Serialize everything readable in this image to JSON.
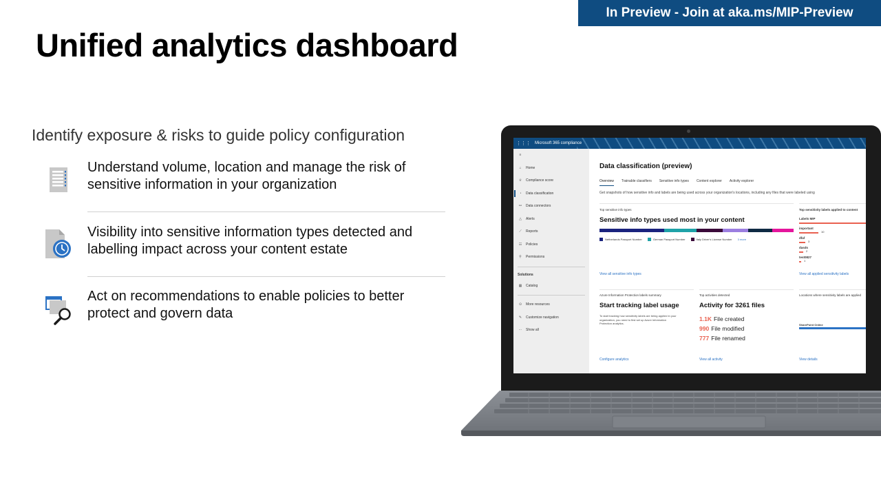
{
  "banner": "In Preview  - Join at aka.ms/MIP-Preview",
  "title": "Unified analytics dashboard",
  "subtitle": "Identify exposure & risks to guide policy configuration",
  "bullets": [
    {
      "icon": "document-list-icon",
      "line1": "Understand volume, location and manage the risk of",
      "line2": "sensitive information in your organization"
    },
    {
      "icon": "document-clock-icon",
      "line1": "Visibility into sensitive information types detected and",
      "line2": "labelling impact across your content estate"
    },
    {
      "icon": "window-search-icon",
      "line1": "Act on recommendations to enable policies to better",
      "line2": "protect and govern data"
    }
  ],
  "app": {
    "name": "Microsoft 365 compliance",
    "nav": [
      "Home",
      "Compliance score",
      "Data classification",
      "Data connectors",
      "Alerts",
      "Reports",
      "Policies",
      "Permissions"
    ],
    "nav_group": "Solutions",
    "nav_solutions": [
      "Catalog"
    ],
    "nav_bottom": [
      "More resources",
      "Customize navigation",
      "Show all"
    ],
    "page_title": "Data classification (preview)",
    "tabs": [
      "Overview",
      "Trainable classifiers",
      "Sensitive info types",
      "Content explorer",
      "Activity explorer"
    ],
    "description": "Get snapshots of how sensitive info and labels are being used across your organization's locations, including any files that were labeled using",
    "card1": {
      "header": "Top sensitive info types",
      "title": "Sensitive info types used most in your content",
      "legend": [
        "Netherlands Passport Number",
        "German Passport Number",
        "Italy Driver's License Number"
      ],
      "more": "3 more",
      "link": "View all sensitive info types"
    },
    "card2": {
      "header": "Top sensitivity labels applied to content",
      "rows": [
        {
          "label": "Labels MIP",
          "value": ""
        },
        {
          "label": "important",
          "value": "10"
        },
        {
          "label": "dfaf",
          "value": "3"
        },
        {
          "label": "dasds",
          "value": "2"
        },
        {
          "label": "test0827",
          "value": "1"
        }
      ],
      "link": "View all applied sensitivity labels"
    },
    "card3": {
      "header": "Azure Information Protection labels summary",
      "title": "Start tracking label usage",
      "body1": "To start tracking how sensitivity labels are being applied in your",
      "body2": "organization, you need to first set up Azure Information",
      "body3": "Protection analytics.",
      "link": "Configure analytics"
    },
    "card4": {
      "header": "Top activities detected",
      "title": "Activity for 3261 files",
      "stats": [
        {
          "n": "1.1K",
          "label": "File created"
        },
        {
          "n": "990",
          "label": "File modified"
        },
        {
          "n": "777",
          "label": "File renamed"
        }
      ],
      "link": "View all activity"
    },
    "card5": {
      "header": "Locations where sensitivity labels are applied",
      "location": "SharePoint Online",
      "link": "View details"
    }
  },
  "colors": {
    "banner": "#0f4c81",
    "stack": [
      "#1a237e",
      "#1fa2a8",
      "#3b0a3a",
      "#9b7ee0",
      "#0f2a44",
      "#e5159c"
    ],
    "bar": "#e9604f"
  }
}
